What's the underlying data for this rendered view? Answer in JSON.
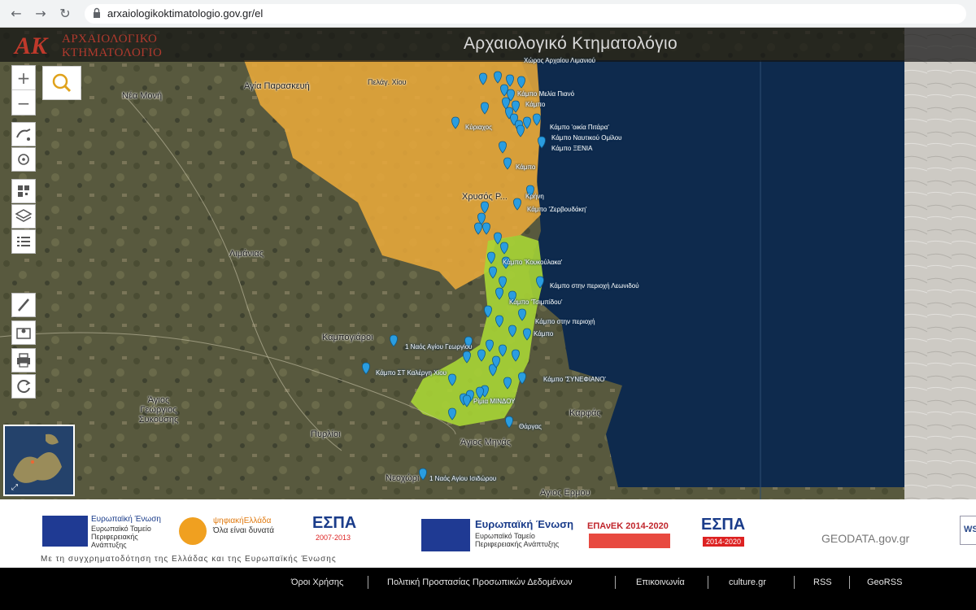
{
  "browser": {
    "url": "arxaiologikoktimatologio.gov.gr/el",
    "back_icon": "arrow-left-icon",
    "forward_icon": "arrow-right-icon",
    "reload_icon": "reload-icon"
  },
  "header": {
    "title": "Αρχαιολογικό Κτηματολόγιο",
    "logo_mark": "AK",
    "logo_line1": "ΑΡΧΑΙΟΛΟΓΙΚΟ",
    "logo_line2": "ΚΤΗΜΑΤΟΛΟΓΙΟ"
  },
  "controls": {
    "zoom_in": "+",
    "zoom_out": "−",
    "tools": [
      "search-icon",
      "location-icon",
      "gps-icon",
      "qr-code-icon",
      "layers-icon",
      "legend-list-icon",
      "measure-icon",
      "map-edit-icon",
      "print-icon",
      "refresh-icon"
    ]
  },
  "colors": {
    "orange_zone": "#e8a93a",
    "green_zone": "#a9d535",
    "marker": "#2a9de0",
    "sea": "#0e2a4d"
  },
  "places": [
    {
      "label": "Νέα Μονή"
    },
    {
      "label": "Αγία Παρασκευή"
    },
    {
      "label": "Λιμάνιας"
    },
    {
      "label": "Καμπογιάροι"
    },
    {
      "label": "Άγιος Γεώργιος Συκούσης"
    },
    {
      "label": "Πυρλίοι"
    },
    {
      "label": "Άγιος Μηνάς"
    },
    {
      "label": "Καρφάς"
    },
    {
      "label": "Νεοχώρι"
    },
    {
      "label": "Χρυσός Ρ..."
    },
    {
      "label": "Πελάγ. Χίου"
    },
    {
      "label": "Αγιος Ερμου"
    }
  ],
  "site_labels": [
    {
      "text": "Χώρος Αρχαίου Λιμανιού"
    },
    {
      "text": "Κάμπο Μελία Πιανό"
    },
    {
      "text": "Κάμπο"
    },
    {
      "text": "Κύριαχος"
    },
    {
      "text": "Κάμπο 'οικία Πιτάρα'"
    },
    {
      "text": "Κάμπο Ναυτικού Ομίλου"
    },
    {
      "text": "Κάμπο ΞΕΝΙΑ"
    },
    {
      "text": "Κάμπο"
    },
    {
      "text": "Κρήνη"
    },
    {
      "text": "Κάμπο 'Ζερβουδάκη'"
    },
    {
      "text": "Κάμπο 'Κουκούλακα'"
    },
    {
      "text": "Κάμπο στην περιοχή Λεωνιδού"
    },
    {
      "text": "Κάμπο 'Τσιμπίδου'"
    },
    {
      "text": "Κάμπο στην περιοχή"
    },
    {
      "text": "Κάμπο"
    },
    {
      "text": "1 Ναός Αγίου Γεωργίου"
    },
    {
      "text": "Κάμπο ΣΤ Καλέργη Χίου"
    },
    {
      "text": "Κάμπο 'ΣΥΝΕΦΙΑΝΟ'"
    },
    {
      "text": "Ρίμια ΜΙΝΔΟΥ"
    },
    {
      "text": "Θάργας"
    },
    {
      "text": "1 Ναός Αγίου Ισιδώρου"
    }
  ],
  "sites": {
    "marker_count": 60
  },
  "partners": {
    "eu_union_line1": "Ευρωπαϊκή Ένωση",
    "eu_union_line2": "Ευρωπαϊκό Ταμείο",
    "eu_union_line3": "Περιφερειακής",
    "eu_union_line4": "Ανάπτυξης",
    "digital_greece": "ψηφιακήΕλλάδα",
    "digital_greece_sub": "Όλα είναι δυνατά",
    "espa1": "ΕΣΠΑ",
    "espa1_years": "2007-2013",
    "eu2_line1": "Ευρωπαϊκή Ένωση",
    "eu2_line2": "Ευρωπαϊκό Ταμείο",
    "eu2_line3": "Περιφερειακής Ανάπτυξης",
    "epanek": "ΕΠΑνΕΚ 2014-2020",
    "espa2": "ΕΣΠΑ",
    "espa2_years": "2014-2020",
    "geodata": "GEODATA.gov.gr",
    "ws": "WS",
    "note": "Με τη συγχρηματοδότηση της Ελλάδας και της Ευρωπαϊκής Ένωσης"
  },
  "footer": {
    "links": [
      "Όροι Χρήσης",
      "Πολιτική Προστασίας Προσωπικών Δεδομένων",
      "Επικοινωνία",
      "culture.gr",
      "RSS",
      "GeoRSS"
    ]
  }
}
